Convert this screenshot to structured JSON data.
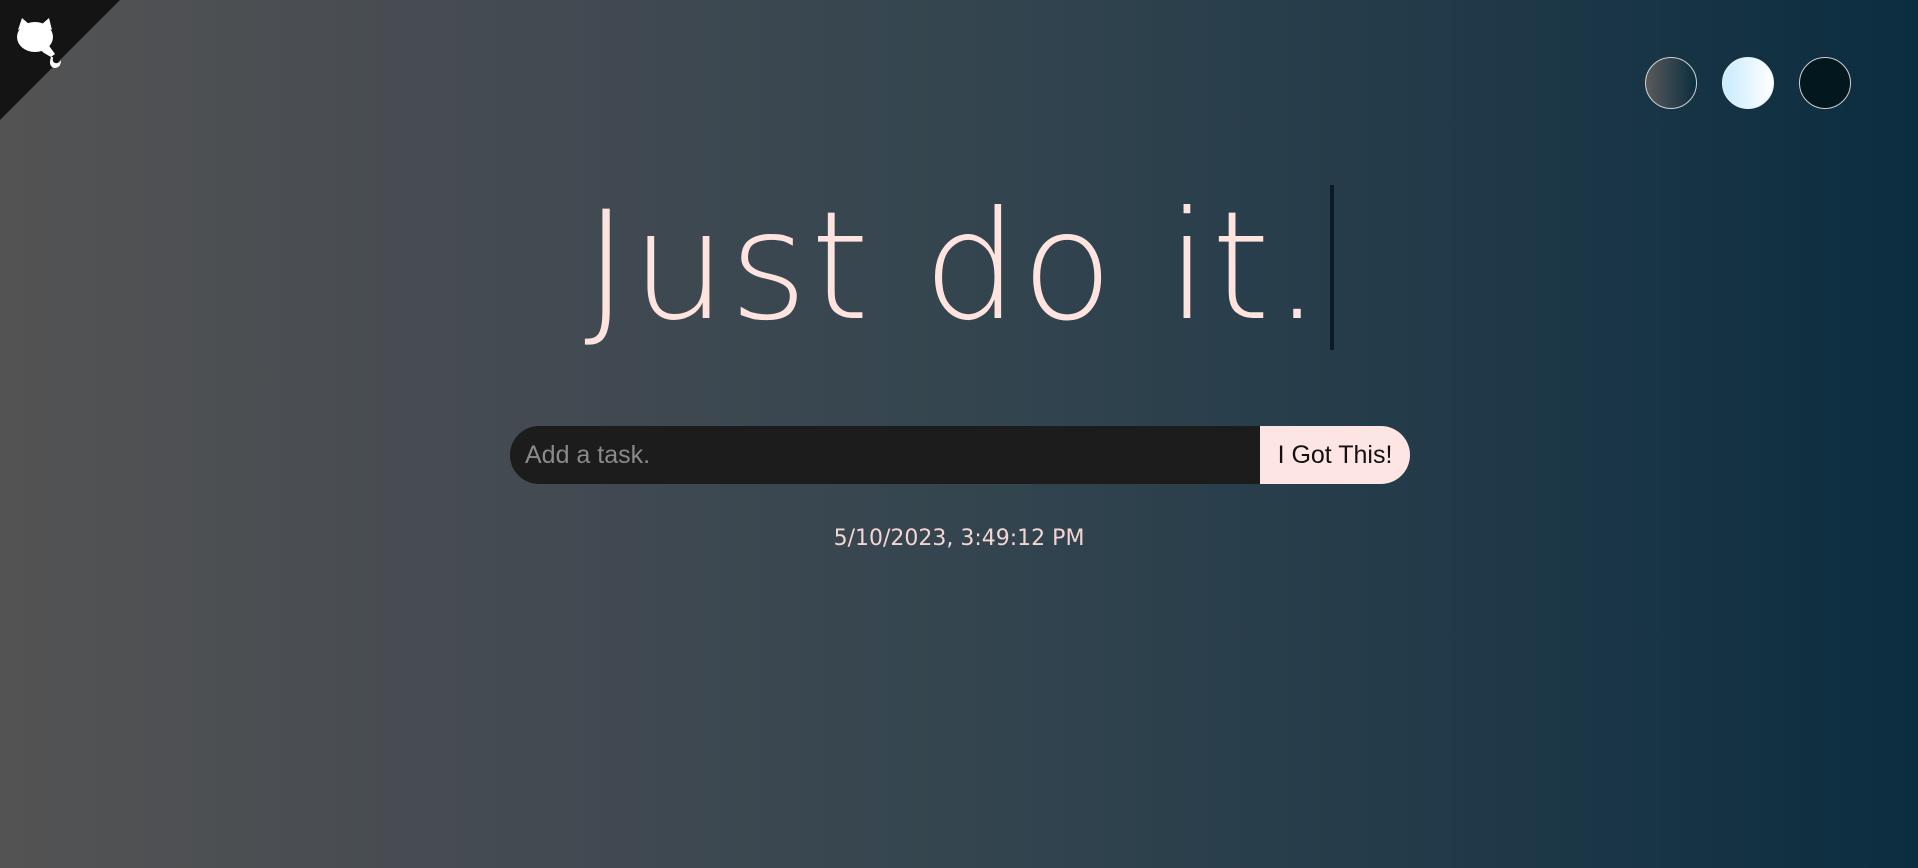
{
  "header": {
    "github_link_icon": "github-octocat-icon"
  },
  "themes": [
    {
      "name": "standard",
      "icon": "standard-theme-swatch"
    },
    {
      "name": "light",
      "icon": "light-theme-swatch"
    },
    {
      "name": "darker",
      "icon": "darker-theme-swatch"
    }
  ],
  "main": {
    "title": "Just do it."
  },
  "todo_form": {
    "input_placeholder": "Add a task.",
    "input_value": "",
    "submit_label": "I Got This!"
  },
  "datetime": "5/10/2023, 3:49:12 PM",
  "colors": {
    "title": "#ffe3df",
    "button_bg": "#fde5e3",
    "input_bg": "#1b1c1b",
    "gradient_start": "#535353",
    "gradient_end": "#0b2d40"
  }
}
